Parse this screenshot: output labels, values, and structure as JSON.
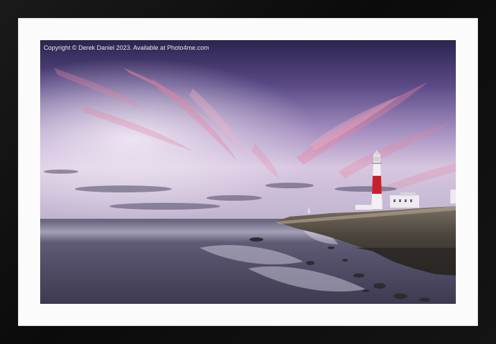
{
  "photo": {
    "copyright_text": "Copyright © Derek Daniel 2023. Available at Photo4me.com",
    "subject": "lighthouse-seascape"
  },
  "colors": {
    "frame": "#111111",
    "mat": "#fbfbfb",
    "lighthouse_band": "#c8202a"
  }
}
